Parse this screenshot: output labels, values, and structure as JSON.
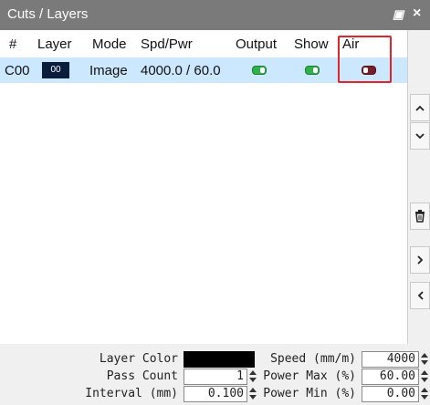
{
  "panel": {
    "title": "Cuts / Layers",
    "float_glyph": "▣",
    "close_glyph": "×"
  },
  "table": {
    "columns": [
      "#",
      "Layer",
      "Mode",
      "Spd/Pwr",
      "Output",
      "Show",
      "Air"
    ],
    "rows": [
      {
        "id": "C00",
        "layer": "00",
        "mode": "Image",
        "spd_pwr": "4000.0 / 60.0",
        "output": true,
        "show": true,
        "air": false
      }
    ]
  },
  "side_buttons": [
    "chevron-up",
    "chevron-down",
    "trash",
    "chevron-right",
    "chevron-left"
  ],
  "settings": {
    "layer_color_label": "Layer Color",
    "layer_color": "#000000",
    "pass_count_label": "Pass Count",
    "pass_count": "1",
    "interval_label": "Interval (mm)",
    "interval": "0.100",
    "speed_label": "Speed (mm/m)",
    "speed": "4000",
    "power_max_label": "Power Max (%)",
    "power_max": "60.00",
    "power_min_label": "Power Min (%)",
    "power_min": "0.00"
  },
  "colors": {
    "accent_highlight": "#e0242a",
    "toggle_on": "#2bb34a",
    "toggle_off": "#7a1f2a",
    "row_selected": "#cce8ff"
  }
}
